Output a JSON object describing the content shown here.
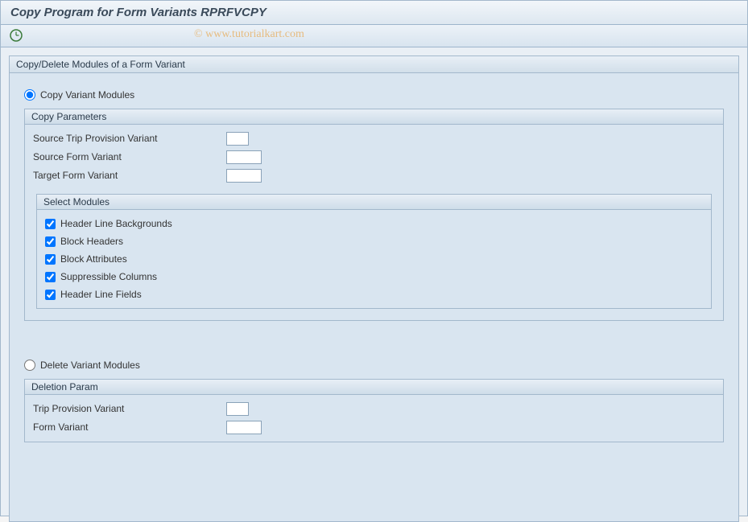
{
  "title": "Copy Program for Form Variants RPRFVCPY",
  "watermark": "© www.tutorialkart.com",
  "mainGroup": {
    "title": "Copy/Delete Modules of a Form Variant",
    "radioCopy": "Copy Variant Modules",
    "radioDelete": "Delete Variant Modules"
  },
  "copyParams": {
    "title": "Copy Parameters",
    "sourceTripProvision": "Source Trip Provision Variant",
    "sourceFormVariant": "Source Form Variant",
    "targetFormVariant": "Target Form Variant",
    "values": {
      "sourceTripProvision": "",
      "sourceFormVariant": "",
      "targetFormVariant": ""
    }
  },
  "selectModules": {
    "title": "Select Modules",
    "items": [
      {
        "label": "Header Line Backgrounds",
        "checked": true
      },
      {
        "label": "Block Headers",
        "checked": true
      },
      {
        "label": "Block Attributes",
        "checked": true
      },
      {
        "label": "Suppressible Columns",
        "checked": true
      },
      {
        "label": "Header Line Fields",
        "checked": true
      }
    ]
  },
  "deletionParam": {
    "title": "Deletion Param",
    "tripProvision": "Trip Provision Variant",
    "formVariant": "Form Variant",
    "values": {
      "tripProvision": "",
      "formVariant": ""
    }
  }
}
